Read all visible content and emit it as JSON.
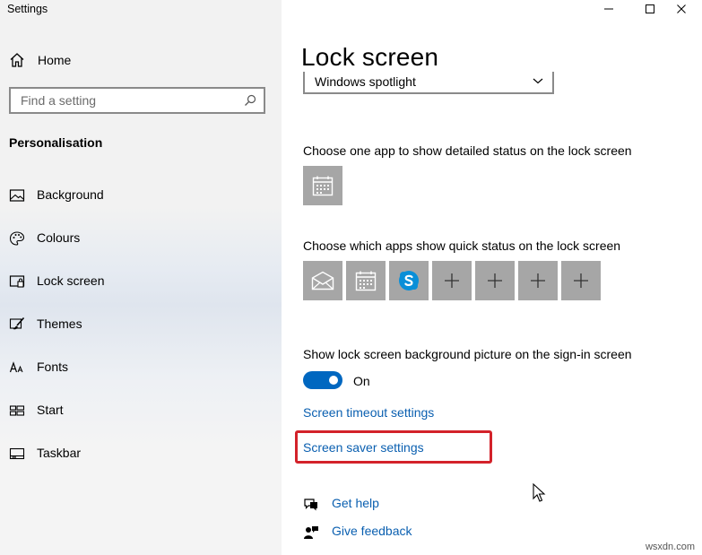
{
  "window": {
    "title": "Settings"
  },
  "titlebar": {
    "minimize": "minimize",
    "maximize": "maximize",
    "close": "close"
  },
  "sidebar": {
    "home_label": "Home",
    "search_placeholder": "Find a setting",
    "section_title": "Personalisation",
    "items": [
      {
        "label": "Background",
        "icon": "image-icon"
      },
      {
        "label": "Colours",
        "icon": "palette-icon"
      },
      {
        "label": "Lock screen",
        "icon": "lock-screen-icon",
        "selected": true
      },
      {
        "label": "Themes",
        "icon": "brush-icon"
      },
      {
        "label": "Fonts",
        "icon": "font-icon"
      },
      {
        "label": "Start",
        "icon": "start-icon"
      },
      {
        "label": "Taskbar",
        "icon": "taskbar-icon"
      }
    ]
  },
  "main": {
    "title": "Lock screen",
    "background_dropdown": {
      "value": "Windows spotlight"
    },
    "detailed_status_label": "Choose one app to show detailed status on the lock screen",
    "detailed_status_app": "calendar-icon",
    "quick_status_label": "Choose which apps show quick status on the lock screen",
    "quick_status_apps": [
      "mail-icon",
      "calendar-icon",
      "skype-icon",
      "plus-icon",
      "plus-icon",
      "plus-icon",
      "plus-icon"
    ],
    "signin_bg_label": "Show lock screen background picture on the sign-in screen",
    "signin_bg_toggle": {
      "state": "On",
      "on": true
    },
    "screen_timeout_link": "Screen timeout settings",
    "screen_saver_link": "Screen saver settings",
    "get_help": "Get help",
    "give_feedback": "Give feedback"
  },
  "colors": {
    "accent": "#0067c0",
    "link": "#0a5fb0",
    "highlight": "#d3222a",
    "tile": "#a6a6a6"
  },
  "watermark": "wsxdn.com"
}
